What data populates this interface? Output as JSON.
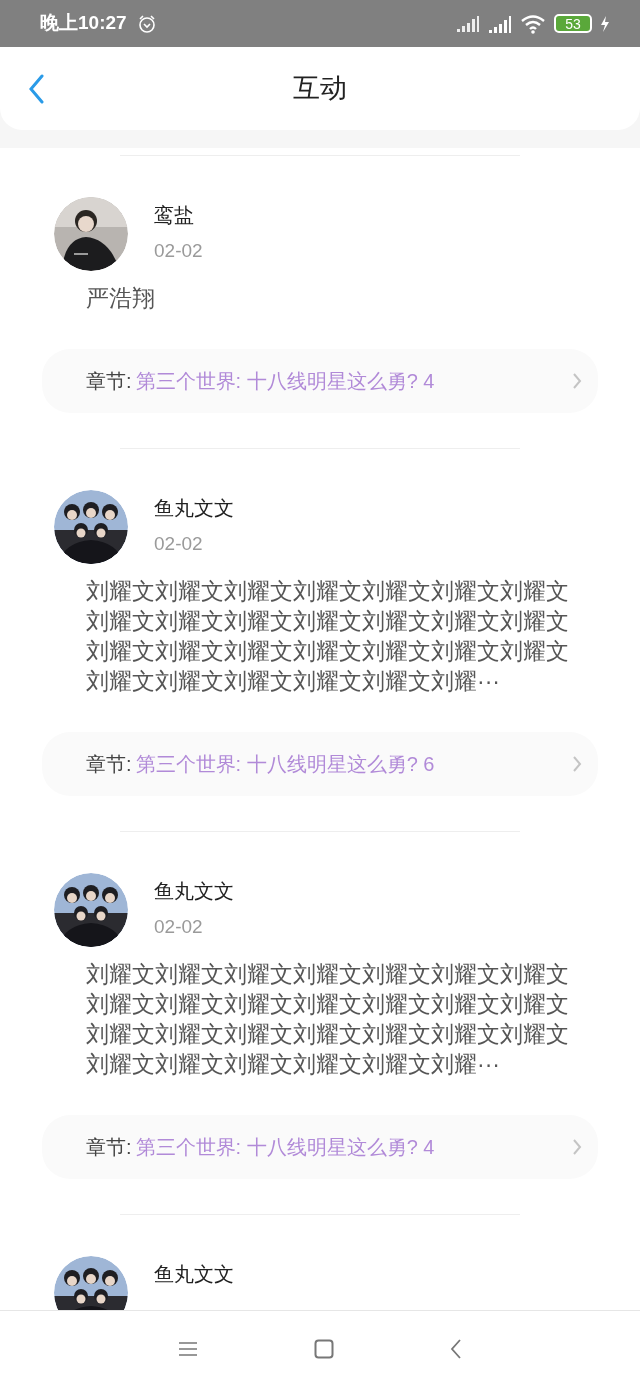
{
  "status_bar": {
    "time": "晚上10:27",
    "battery": "53"
  },
  "header": {
    "title": "互动"
  },
  "comments": [
    {
      "name": "鸾盐",
      "date": "02-02",
      "text": "严浩翔",
      "chapter_label": "章节:",
      "chapter": "第三个世界: 十八线明星这么勇? 4"
    },
    {
      "name": "鱼丸文文",
      "date": "02-02",
      "text": "刘耀文刘耀文刘耀文刘耀文刘耀文刘耀文刘耀文刘耀文刘耀文刘耀文刘耀文刘耀文刘耀文刘耀文刘耀文刘耀文刘耀文刘耀文刘耀文刘耀文刘耀文刘耀文刘耀文刘耀文刘耀文刘耀文刘耀···",
      "chapter_label": "章节:",
      "chapter": "第三个世界: 十八线明星这么勇? 6"
    },
    {
      "name": "鱼丸文文",
      "date": "02-02",
      "text": "刘耀文刘耀文刘耀文刘耀文刘耀文刘耀文刘耀文刘耀文刘耀文刘耀文刘耀文刘耀文刘耀文刘耀文刘耀文刘耀文刘耀文刘耀文刘耀文刘耀文刘耀文刘耀文刘耀文刘耀文刘耀文刘耀文刘耀···",
      "chapter_label": "章节:",
      "chapter": "第三个世界: 十八线明星这么勇? 4"
    },
    {
      "name": "鱼丸文文"
    }
  ]
}
